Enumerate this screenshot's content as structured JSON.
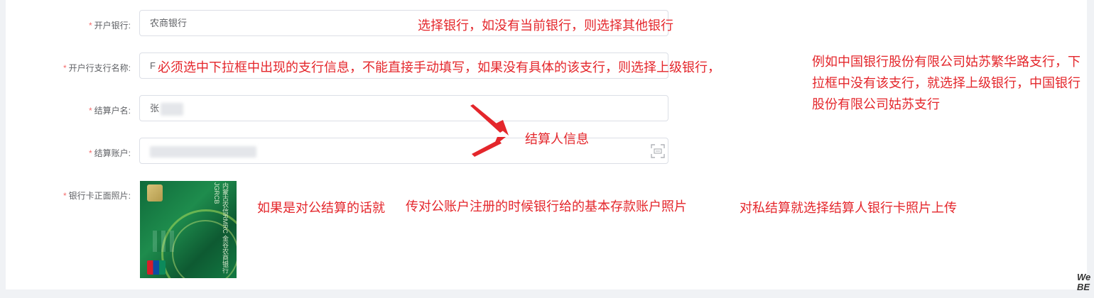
{
  "form": {
    "bank": {
      "label": "开户银行:",
      "value": "农商银行"
    },
    "branch": {
      "label": "开户行支行名称:",
      "value_visible": "F"
    },
    "account_name": {
      "label": "结算户名:",
      "value_visible": "张"
    },
    "account_number": {
      "label": "结算账户:"
    },
    "card_photo": {
      "label": "银行卡正面照片:"
    }
  },
  "card_image": {
    "brand_text": "内蒙古农信RMRC 金谷农商银行JGRCB"
  },
  "annotations": {
    "bank_hint": "选择银行，如没有当前银行，则选择其他银行",
    "branch_hint": "必须选中下拉框中出现的支行信息，不能直接手动填写，如果没有具体的该支行，则选择上级银行，",
    "branch_example": "例如中国银行股份有限公司姑苏繁华路支行，下拉框中没有该支行，就选择上级银行，中国银行股份有限公司姑苏支行",
    "settlement_info": "结算人信息",
    "corporate_hint": "如果是对公结算的话就",
    "corporate_detail": "传对公账户注册的时候银行给的基本存款账户照片",
    "private_hint": "对私结算就选择结算人银行卡照片上传"
  },
  "watermark": "We BE",
  "colors": {
    "annotation_red": "#e4262b",
    "required_red": "#f56c6c",
    "label_gray": "#606266"
  },
  "icons": {
    "scan": "scan-icon",
    "arrow": "red-arrow-icon"
  }
}
